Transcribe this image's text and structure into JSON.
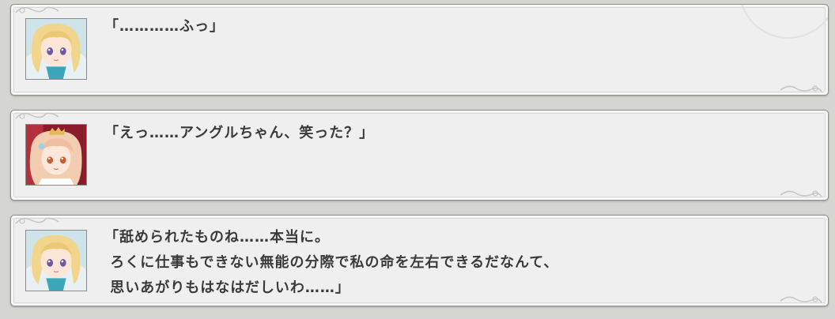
{
  "log": [
    {
      "portrait_icon": "blonde-character-portrait-icon",
      "text": "「…………ふっ」"
    },
    {
      "portrait_icon": "strawberry-blonde-character-portrait-icon",
      "text": "「えっ……アングルちゃん、笑った？」"
    },
    {
      "portrait_icon": "blonde-character-portrait-icon",
      "text": "「舐められたものね……本当に。\n ろくに仕事もできない無能の分際で私の命を左右できるだなんて、\n 思いあがりもはなはだしいわ……」"
    }
  ],
  "colors": {
    "background": "#d5d5d2",
    "box": "#efefef",
    "border": "#8e8e8e",
    "text": "#3a3a3a"
  }
}
